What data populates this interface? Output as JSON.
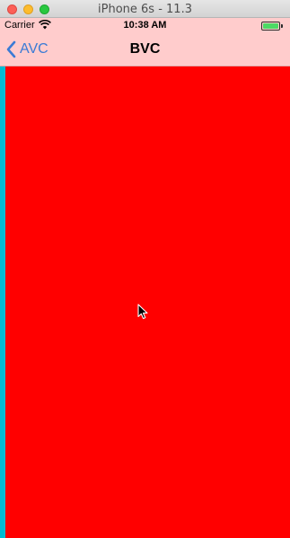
{
  "window": {
    "title": "iPhone 6s - 11.3"
  },
  "status_bar": {
    "carrier": "Carrier",
    "time": "10:38 AM",
    "battery_level": 1.0
  },
  "nav_bar": {
    "back_label": "AVC",
    "title": "BVC"
  },
  "colors": {
    "nav_background": "#ffcccc",
    "content_background": "#ff0000",
    "edge_strip": "#00bcd4",
    "tint": "#3a7bd5"
  },
  "icons": {
    "window_controls": [
      "close-icon",
      "minimize-icon",
      "zoom-icon"
    ],
    "status": [
      "wifi-icon",
      "battery-icon"
    ],
    "back": "chevron-left-icon",
    "pointer": "mouse-cursor-icon"
  }
}
